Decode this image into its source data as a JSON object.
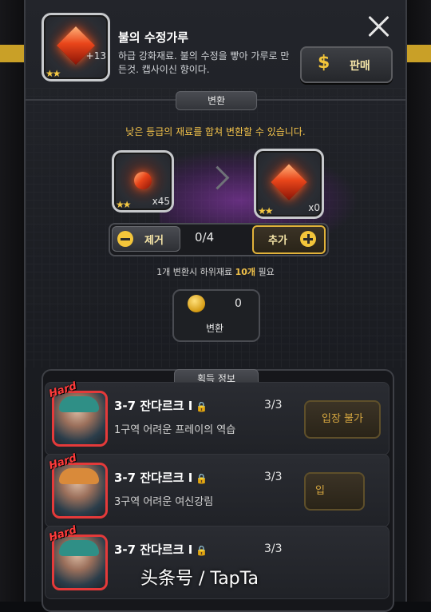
{
  "header": {
    "title": "불의 수정가루",
    "description": "하급 강화재료. 불의 수정을 빻아 가루로 만든것. 캡사이신 향이다.",
    "item_qty": "13",
    "stars": "★★",
    "sell_label": "판매",
    "sell_icon": "$"
  },
  "convert": {
    "tab_label": "변환",
    "hint": "낮은 등급의 재료를 합쳐 변환할 수 있습니다.",
    "source_qty": "x45",
    "target_qty": "x0",
    "remove_label": "제거",
    "add_label": "추가",
    "counter": "0/4",
    "need_prefix": "1개 변환시 하위재료 ",
    "need_count": "10개",
    "need_suffix": " 필요",
    "coin_amount": "0",
    "convert_label": "변환"
  },
  "acquire": {
    "tab_label": "획득 정보",
    "rows": [
      {
        "badge": "Hard",
        "stage": "3-7 잔다르크 I",
        "subtitle": "1구역 어려운 프레이의 역습",
        "count": "3/3",
        "button": "입장 불가"
      },
      {
        "badge": "Hard",
        "stage": "3-7 잔다르크 I",
        "subtitle": "3구역 어려운 여신강림",
        "count": "3/3",
        "button": "입"
      },
      {
        "badge": "Hard",
        "stage": "3-7 잔다르크 I",
        "subtitle": "",
        "count": "3/3",
        "button": ""
      }
    ]
  },
  "watermark": "头条号 / TapTa",
  "colors": {
    "accent_gold": "#f2c24a",
    "hard_red": "#ff3b3b",
    "panel_bg": "#1a1c21"
  }
}
